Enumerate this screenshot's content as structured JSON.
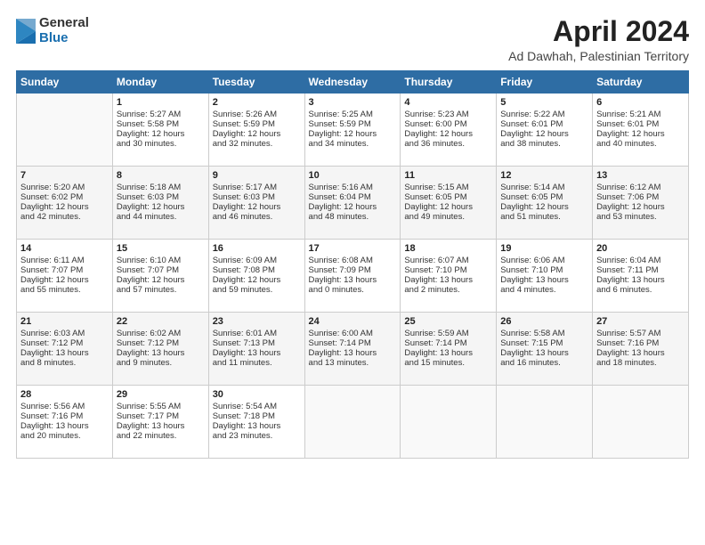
{
  "logo": {
    "general": "General",
    "blue": "Blue"
  },
  "title": "April 2024",
  "subtitle": "Ad Dawhah, Palestinian Territory",
  "days_header": [
    "Sunday",
    "Monday",
    "Tuesday",
    "Wednesday",
    "Thursday",
    "Friday",
    "Saturday"
  ],
  "weeks": [
    [
      {
        "num": "",
        "content": ""
      },
      {
        "num": "1",
        "content": "Sunrise: 5:27 AM\nSunset: 5:58 PM\nDaylight: 12 hours\nand 30 minutes."
      },
      {
        "num": "2",
        "content": "Sunrise: 5:26 AM\nSunset: 5:59 PM\nDaylight: 12 hours\nand 32 minutes."
      },
      {
        "num": "3",
        "content": "Sunrise: 5:25 AM\nSunset: 5:59 PM\nDaylight: 12 hours\nand 34 minutes."
      },
      {
        "num": "4",
        "content": "Sunrise: 5:23 AM\nSunset: 6:00 PM\nDaylight: 12 hours\nand 36 minutes."
      },
      {
        "num": "5",
        "content": "Sunrise: 5:22 AM\nSunset: 6:01 PM\nDaylight: 12 hours\nand 38 minutes."
      },
      {
        "num": "6",
        "content": "Sunrise: 5:21 AM\nSunset: 6:01 PM\nDaylight: 12 hours\nand 40 minutes."
      }
    ],
    [
      {
        "num": "7",
        "content": "Sunrise: 5:20 AM\nSunset: 6:02 PM\nDaylight: 12 hours\nand 42 minutes."
      },
      {
        "num": "8",
        "content": "Sunrise: 5:18 AM\nSunset: 6:03 PM\nDaylight: 12 hours\nand 44 minutes."
      },
      {
        "num": "9",
        "content": "Sunrise: 5:17 AM\nSunset: 6:03 PM\nDaylight: 12 hours\nand 46 minutes."
      },
      {
        "num": "10",
        "content": "Sunrise: 5:16 AM\nSunset: 6:04 PM\nDaylight: 12 hours\nand 48 minutes."
      },
      {
        "num": "11",
        "content": "Sunrise: 5:15 AM\nSunset: 6:05 PM\nDaylight: 12 hours\nand 49 minutes."
      },
      {
        "num": "12",
        "content": "Sunrise: 5:14 AM\nSunset: 6:05 PM\nDaylight: 12 hours\nand 51 minutes."
      },
      {
        "num": "13",
        "content": "Sunrise: 6:12 AM\nSunset: 7:06 PM\nDaylight: 12 hours\nand 53 minutes."
      }
    ],
    [
      {
        "num": "14",
        "content": "Sunrise: 6:11 AM\nSunset: 7:07 PM\nDaylight: 12 hours\nand 55 minutes."
      },
      {
        "num": "15",
        "content": "Sunrise: 6:10 AM\nSunset: 7:07 PM\nDaylight: 12 hours\nand 57 minutes."
      },
      {
        "num": "16",
        "content": "Sunrise: 6:09 AM\nSunset: 7:08 PM\nDaylight: 12 hours\nand 59 minutes."
      },
      {
        "num": "17",
        "content": "Sunrise: 6:08 AM\nSunset: 7:09 PM\nDaylight: 13 hours\nand 0 minutes."
      },
      {
        "num": "18",
        "content": "Sunrise: 6:07 AM\nSunset: 7:10 PM\nDaylight: 13 hours\nand 2 minutes."
      },
      {
        "num": "19",
        "content": "Sunrise: 6:06 AM\nSunset: 7:10 PM\nDaylight: 13 hours\nand 4 minutes."
      },
      {
        "num": "20",
        "content": "Sunrise: 6:04 AM\nSunset: 7:11 PM\nDaylight: 13 hours\nand 6 minutes."
      }
    ],
    [
      {
        "num": "21",
        "content": "Sunrise: 6:03 AM\nSunset: 7:12 PM\nDaylight: 13 hours\nand 8 minutes."
      },
      {
        "num": "22",
        "content": "Sunrise: 6:02 AM\nSunset: 7:12 PM\nDaylight: 13 hours\nand 9 minutes."
      },
      {
        "num": "23",
        "content": "Sunrise: 6:01 AM\nSunset: 7:13 PM\nDaylight: 13 hours\nand 11 minutes."
      },
      {
        "num": "24",
        "content": "Sunrise: 6:00 AM\nSunset: 7:14 PM\nDaylight: 13 hours\nand 13 minutes."
      },
      {
        "num": "25",
        "content": "Sunrise: 5:59 AM\nSunset: 7:14 PM\nDaylight: 13 hours\nand 15 minutes."
      },
      {
        "num": "26",
        "content": "Sunrise: 5:58 AM\nSunset: 7:15 PM\nDaylight: 13 hours\nand 16 minutes."
      },
      {
        "num": "27",
        "content": "Sunrise: 5:57 AM\nSunset: 7:16 PM\nDaylight: 13 hours\nand 18 minutes."
      }
    ],
    [
      {
        "num": "28",
        "content": "Sunrise: 5:56 AM\nSunset: 7:16 PM\nDaylight: 13 hours\nand 20 minutes."
      },
      {
        "num": "29",
        "content": "Sunrise: 5:55 AM\nSunset: 7:17 PM\nDaylight: 13 hours\nand 22 minutes."
      },
      {
        "num": "30",
        "content": "Sunrise: 5:54 AM\nSunset: 7:18 PM\nDaylight: 13 hours\nand 23 minutes."
      },
      {
        "num": "",
        "content": ""
      },
      {
        "num": "",
        "content": ""
      },
      {
        "num": "",
        "content": ""
      },
      {
        "num": "",
        "content": ""
      }
    ]
  ]
}
